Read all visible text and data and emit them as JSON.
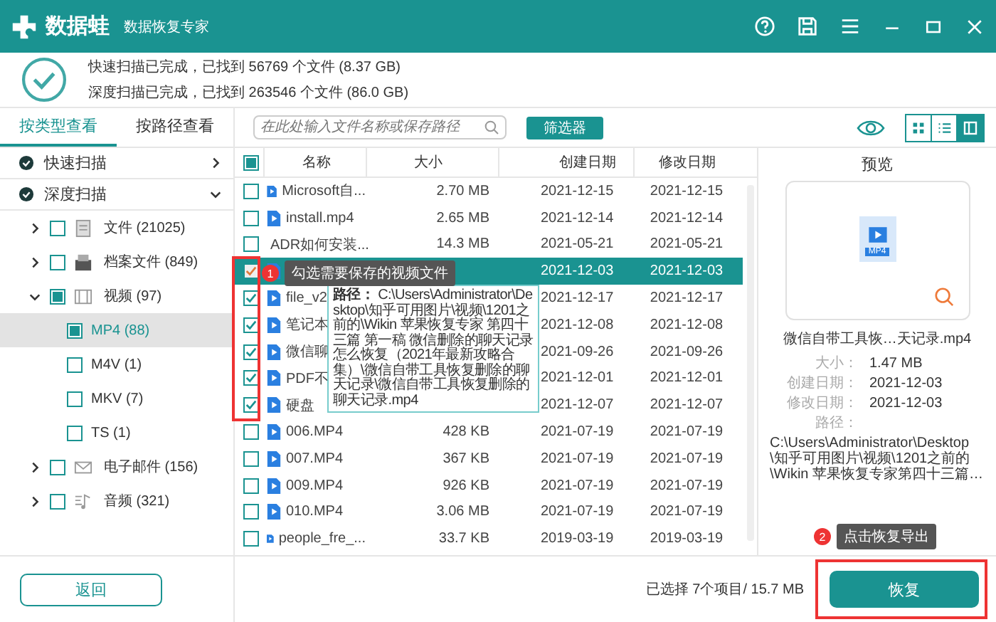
{
  "window": {
    "app_name": "数据蛙",
    "subtitle": "数据恢复专家"
  },
  "scan_summary": [
    "快速扫描已完成，已找到 56769 个文件 (8.37 GB)",
    "深度扫描已完成，已找到 263546 个文件 (86.0 GB)"
  ],
  "view_tabs": [
    {
      "label": "按类型查看",
      "selected": true
    },
    {
      "label": "按路径查看",
      "selected": false
    }
  ],
  "search": {
    "placeholder": "在此处输入文件名称或保存路径"
  },
  "filter_button": "筛选器",
  "view_modes": [
    {
      "kind": "grid",
      "selected": false
    },
    {
      "kind": "list",
      "selected": false
    },
    {
      "kind": "preview",
      "selected": true
    }
  ],
  "scans": [
    {
      "label": "快速扫描",
      "expanded": false
    },
    {
      "label": "深度扫描",
      "expanded": true
    }
  ],
  "tree": [
    {
      "label": "文件 (21025)",
      "kind": "document",
      "checked": false,
      "partial": false,
      "expanded": false,
      "selected": false
    },
    {
      "label": "档案文件 (849)",
      "kind": "archive",
      "checked": false,
      "partial": false,
      "expanded": false,
      "selected": false
    },
    {
      "label": "视频 (97)",
      "kind": "video",
      "checked": false,
      "partial": true,
      "expanded": true,
      "selected": false,
      "children": [
        {
          "label": "MP4 (88)",
          "checked": false,
          "partial": true,
          "selected": true
        },
        {
          "label": "M4V (1)",
          "checked": false,
          "partial": false,
          "selected": false
        },
        {
          "label": "MKV (7)",
          "checked": false,
          "partial": false,
          "selected": false
        },
        {
          "label": "TS (1)",
          "checked": false,
          "partial": false,
          "selected": false
        }
      ]
    },
    {
      "label": "电子邮件 (156)",
      "kind": "mail",
      "checked": false,
      "partial": false,
      "expanded": false,
      "selected": false
    },
    {
      "label": "音频 (321)",
      "kind": "audio",
      "checked": false,
      "partial": false,
      "expanded": false,
      "selected": false
    }
  ],
  "table": {
    "header_checked": false,
    "header_partial": true,
    "columns": [
      "名称",
      "大小",
      "创建日期",
      "修改日期"
    ],
    "rows": [
      {
        "name": "Microsoft自...",
        "size": "2.70 MB",
        "created": "2021-12-15",
        "modified": "2021-12-15",
        "checked": false,
        "selected": false
      },
      {
        "name": "install.mp4",
        "size": "2.65 MB",
        "created": "2021-12-14",
        "modified": "2021-12-14",
        "checked": false,
        "selected": false
      },
      {
        "name": "ADR如何安装...",
        "size": "14.3 MB",
        "created": "2021-05-21",
        "modified": "2021-05-21",
        "checked": false,
        "selected": false
      },
      {
        "created": "2021-12-03",
        "modified": "2021-12-03",
        "checked": true,
        "selected": true
      },
      {
        "name": "file_v2",
        "created": "2021-12-17",
        "modified": "2021-12-17",
        "checked": true,
        "selected": false
      },
      {
        "name": "笔记本",
        "created": "2021-12-08",
        "modified": "2021-12-08",
        "checked": true,
        "selected": false
      },
      {
        "name": "微信聊",
        "created": "2021-09-26",
        "modified": "2021-09-26",
        "checked": true,
        "selected": false
      },
      {
        "name": "PDF不",
        "created": "2021-12-01",
        "modified": "2021-12-01",
        "checked": true,
        "selected": false
      },
      {
        "name": "硬盘",
        "created": "2021-12-07",
        "modified": "2021-12-07",
        "checked": true,
        "selected": false
      },
      {
        "name": "006.MP4",
        "size": "428 KB",
        "created": "2021-07-19",
        "modified": "2021-07-19",
        "checked": false,
        "selected": false
      },
      {
        "name": "007.MP4",
        "size": "367 KB",
        "created": "2021-07-19",
        "modified": "2021-07-19",
        "checked": false,
        "selected": false
      },
      {
        "name": "009.MP4",
        "size": "926 KB",
        "created": "2021-07-19",
        "modified": "2021-07-19",
        "checked": false,
        "selected": false
      },
      {
        "name": "010.MP4",
        "size": "3.06 MB",
        "created": "2021-07-19",
        "modified": "2021-07-19",
        "checked": false,
        "selected": false
      },
      {
        "name": "people_fre_...",
        "size": "33.7 KB",
        "created": "2019-03-19",
        "modified": "2019-03-19",
        "checked": false,
        "selected": false
      }
    ]
  },
  "path_tooltip": "**路径：** C:\\Users\\Administrator\\Desktop\\知乎可用图片\\视频\\1201之前的\\Wikin 苹果恢复专家 第四十三篇 第一稿 微信删除的聊天记录怎么恢复（2021年最新攻略合集）\\微信自带工具恢复删除的聊天记录\\微信自带工具恢复删除的聊天记录.mp4",
  "preview": {
    "title": "预览",
    "file_badge": "MP4",
    "file_name": "微信自带工具恢…天记录.mp4",
    "fields": [
      {
        "label": "大小：",
        "value": "1.47 MB"
      },
      {
        "label": "创建日期：",
        "value": "2021-12-03"
      },
      {
        "label": "修改日期：",
        "value": "2021-12-03"
      }
    ],
    "path_label": "路径：",
    "path": "C:\\Users\\Administrator\\Desktop\\知乎可用图片\\视频\\1201之前的\\Wikin 苹果恢复专家第四十三篇…"
  },
  "status": "已选择 7个项目/ 15.7 MB",
  "back_button": "返回",
  "recover_button": "恢复",
  "annotations": [
    {
      "number": "1",
      "text": "勾选需要保存的视频文件"
    },
    {
      "number": "2",
      "text": "点击恢复导出"
    }
  ]
}
